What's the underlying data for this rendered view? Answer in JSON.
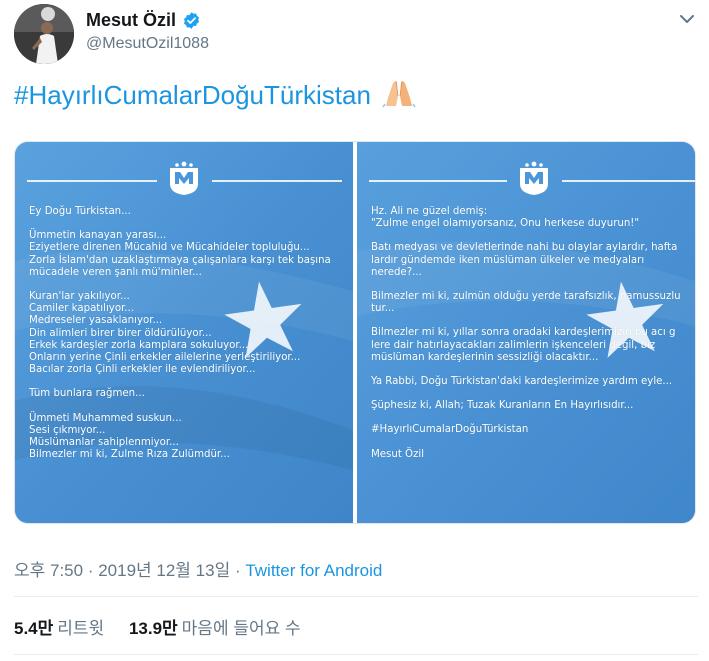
{
  "user": {
    "display_name": "Mesut Özil",
    "username": "@MesutOzil1088"
  },
  "tweet": {
    "text": "#HayırlıCumalarDoğuTürkistan",
    "emoji": "folded-hands-emoji"
  },
  "images": {
    "left": {
      "lines": [
        "Ey Doğu Türkistan...",
        "",
        "Ümmetin kanayan yarası...",
        "Eziyetlere direnen Mücahid ve Mücahideler topluluğu...",
        "Zorla İslam'dan uzaklaştırmaya çalışanlara karşı tek başına",
        "mücadele veren şanlı mü'minler...",
        "",
        "Kuran'lar yakılıyor...",
        "Camiler kapatılıyor...",
        "Medreseler yasaklanıyor...",
        "Din alimleri birer birer öldürülüyor...",
        "Erkek kardeşler zorla kamplara sokuluyor...",
        "Onların yerine Çinli erkekler ailelerine yerleştiriliyor...",
        "Bacılar zorla Çinli erkekler ile evlendiriliyor...",
        "",
        "Tüm bunlara rağmen...",
        "",
        "Ümmeti Muhammed suskun...",
        "Sesi çıkmıyor...",
        "Müslümanlar sahiplenmiyor...",
        "Bilmezler mi ki, Zulme Rıza Zulümdür..."
      ]
    },
    "right": {
      "lines": [
        "Hz. Ali ne güzel demiş:",
        "\"Zulme engel olamıyorsanız, Onu herkese duyurun!\"",
        "",
        "Batı medyası ve devletlerinde nahi bu olaylar aylardır, hafta",
        "lardır gündemde iken müslüman ülkeler ve medyaları",
        "nerede?...",
        "",
        "Bilmezler mi ki, zulmün olduğu yerde tarafsızlık, namussuzlu",
        "tur...",
        "",
        "Bilmezler mi ki, yıllar sonra oradaki kardeşlerimizin bu acı g",
        "lere dair hatırlayacakları zalimlerin işkenceleri değil, biz",
        "müslüman kardeşlerinin sessizliği olacaktır...",
        "",
        "Ya Rabbi, Doğu Türkistan'daki kardeşlerimize yardım eyle...",
        "",
        "Şüphesiz ki, Allah; Tuzak Kuranların En Hayırlısıdır...",
        "",
        "#HayırlıCumalarDoğuTürkistan",
        "",
        "Mesut Özil"
      ]
    }
  },
  "meta": {
    "time": "오후 7:50",
    "separator1": " · ",
    "date": "2019년 12월 13일",
    "separator2": " · ",
    "source": "Twitter for Android"
  },
  "stats": {
    "retweets_count": "5.4만",
    "retweets_label": "리트윗",
    "likes_count": "13.9만",
    "likes_label": "마음에 들어요 수"
  },
  "colors": {
    "link": "#1b95e0",
    "secondary_text": "#657786",
    "flag_blue": "#4a96d8",
    "verified": "#1da1f2"
  }
}
